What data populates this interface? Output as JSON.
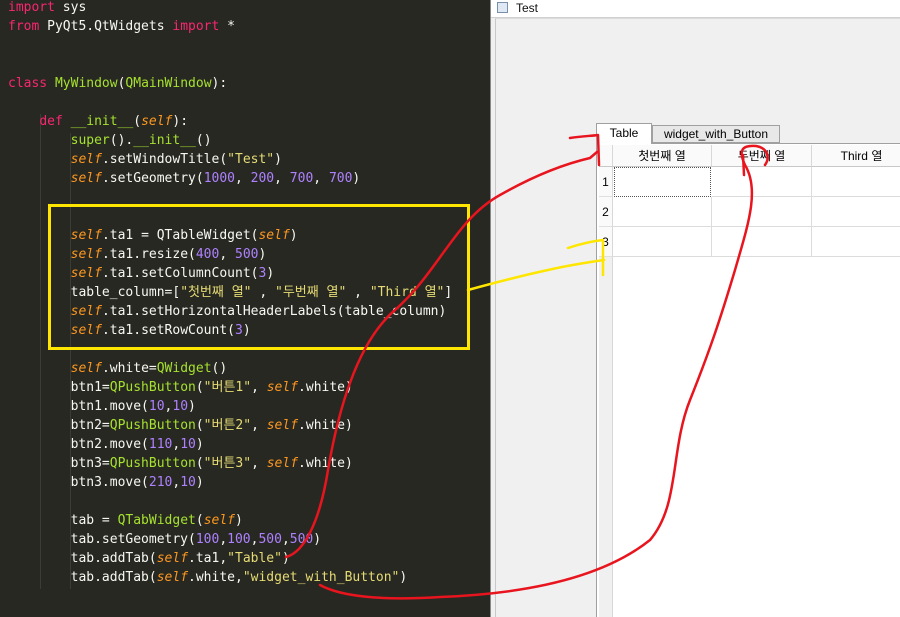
{
  "editor": {
    "lines": [
      [
        {
          "t": "import",
          "c": "kw"
        },
        {
          "t": " sys",
          "c": ""
        }
      ],
      [
        {
          "t": "from",
          "c": "kw"
        },
        {
          "t": " PyQt5.QtWidgets ",
          "c": ""
        },
        {
          "t": "import",
          "c": "kw"
        },
        {
          "t": " *",
          "c": ""
        }
      ],
      [],
      [],
      [
        {
          "t": "class",
          "c": "kw"
        },
        {
          "t": " ",
          "c": ""
        },
        {
          "t": "MyWindow",
          "c": "cls"
        },
        {
          "t": "(",
          "c": ""
        },
        {
          "t": "QMainWindow",
          "c": "cls"
        },
        {
          "t": "):",
          "c": ""
        }
      ],
      [],
      [
        {
          "t": "    ",
          "c": ""
        },
        {
          "t": "def",
          "c": "kw"
        },
        {
          "t": " ",
          "c": ""
        },
        {
          "t": "__init__",
          "c": "fn"
        },
        {
          "t": "(",
          "c": ""
        },
        {
          "t": "self",
          "c": "slf"
        },
        {
          "t": "):",
          "c": ""
        }
      ],
      [
        {
          "t": "        ",
          "c": ""
        },
        {
          "t": "super",
          "c": "fn"
        },
        {
          "t": "().",
          "c": ""
        },
        {
          "t": "__init__",
          "c": "fn"
        },
        {
          "t": "()",
          "c": ""
        }
      ],
      [
        {
          "t": "        ",
          "c": ""
        },
        {
          "t": "self",
          "c": "slf"
        },
        {
          "t": ".setWindowTitle(",
          "c": ""
        },
        {
          "t": "\"Test\"",
          "c": "str"
        },
        {
          "t": ")",
          "c": ""
        }
      ],
      [
        {
          "t": "        ",
          "c": ""
        },
        {
          "t": "self",
          "c": "slf"
        },
        {
          "t": ".setGeometry(",
          "c": ""
        },
        {
          "t": "1000",
          "c": "num"
        },
        {
          "t": ", ",
          "c": ""
        },
        {
          "t": "200",
          "c": "num"
        },
        {
          "t": ", ",
          "c": ""
        },
        {
          "t": "700",
          "c": "num"
        },
        {
          "t": ", ",
          "c": ""
        },
        {
          "t": "700",
          "c": "num"
        },
        {
          "t": ")",
          "c": ""
        }
      ],
      [],
      [],
      [
        {
          "t": "        ",
          "c": ""
        },
        {
          "t": "self",
          "c": "slf"
        },
        {
          "t": ".ta1 = QTableWidget(",
          "c": ""
        },
        {
          "t": "self",
          "c": "slf"
        },
        {
          "t": ")",
          "c": ""
        }
      ],
      [
        {
          "t": "        ",
          "c": ""
        },
        {
          "t": "self",
          "c": "slf"
        },
        {
          "t": ".ta1.resize(",
          "c": ""
        },
        {
          "t": "400",
          "c": "num"
        },
        {
          "t": ", ",
          "c": ""
        },
        {
          "t": "500",
          "c": "num"
        },
        {
          "t": ")",
          "c": ""
        }
      ],
      [
        {
          "t": "        ",
          "c": ""
        },
        {
          "t": "self",
          "c": "slf"
        },
        {
          "t": ".ta1.setColumnCount(",
          "c": ""
        },
        {
          "t": "3",
          "c": "num"
        },
        {
          "t": ")",
          "c": ""
        }
      ],
      [
        {
          "t": "        table_column=[",
          "c": ""
        },
        {
          "t": "\"첫번째 열\"",
          "c": "str"
        },
        {
          "t": " , ",
          "c": ""
        },
        {
          "t": "\"두번째 열\"",
          "c": "str"
        },
        {
          "t": " , ",
          "c": ""
        },
        {
          "t": "\"Third 열\"",
          "c": "str"
        },
        {
          "t": "]",
          "c": ""
        }
      ],
      [
        {
          "t": "        ",
          "c": ""
        },
        {
          "t": "self",
          "c": "slf"
        },
        {
          "t": ".ta1.setHorizontalHeaderLabels(table_column)",
          "c": ""
        }
      ],
      [
        {
          "t": "        ",
          "c": ""
        },
        {
          "t": "self",
          "c": "slf"
        },
        {
          "t": ".ta1.setRowCount(",
          "c": ""
        },
        {
          "t": "3",
          "c": "num"
        },
        {
          "t": ")",
          "c": ""
        }
      ],
      [],
      [
        {
          "t": "        ",
          "c": ""
        },
        {
          "t": "self",
          "c": "slf"
        },
        {
          "t": ".white=",
          "c": ""
        },
        {
          "t": "QWidget",
          "c": "cls"
        },
        {
          "t": "()",
          "c": ""
        }
      ],
      [
        {
          "t": "        btn1=",
          "c": ""
        },
        {
          "t": "QPushButton",
          "c": "cls"
        },
        {
          "t": "(",
          "c": ""
        },
        {
          "t": "\"버튼1\"",
          "c": "str"
        },
        {
          "t": ", ",
          "c": ""
        },
        {
          "t": "self",
          "c": "slf"
        },
        {
          "t": ".white)",
          "c": ""
        }
      ],
      [
        {
          "t": "        btn1.move(",
          "c": ""
        },
        {
          "t": "10",
          "c": "num"
        },
        {
          "t": ",",
          "c": ""
        },
        {
          "t": "10",
          "c": "num"
        },
        {
          "t": ")",
          "c": ""
        }
      ],
      [
        {
          "t": "        btn2=",
          "c": ""
        },
        {
          "t": "QPushButton",
          "c": "cls"
        },
        {
          "t": "(",
          "c": ""
        },
        {
          "t": "\"버튼2\"",
          "c": "str"
        },
        {
          "t": ", ",
          "c": ""
        },
        {
          "t": "self",
          "c": "slf"
        },
        {
          "t": ".white)",
          "c": ""
        }
      ],
      [
        {
          "t": "        btn2.move(",
          "c": ""
        },
        {
          "t": "110",
          "c": "num"
        },
        {
          "t": ",",
          "c": ""
        },
        {
          "t": "10",
          "c": "num"
        },
        {
          "t": ")",
          "c": ""
        }
      ],
      [
        {
          "t": "        btn3=",
          "c": ""
        },
        {
          "t": "QPushButton",
          "c": "cls"
        },
        {
          "t": "(",
          "c": ""
        },
        {
          "t": "\"버튼3\"",
          "c": "str"
        },
        {
          "t": ", ",
          "c": ""
        },
        {
          "t": "self",
          "c": "slf"
        },
        {
          "t": ".white)",
          "c": ""
        }
      ],
      [
        {
          "t": "        btn3.move(",
          "c": ""
        },
        {
          "t": "210",
          "c": "num"
        },
        {
          "t": ",",
          "c": ""
        },
        {
          "t": "10",
          "c": "num"
        },
        {
          "t": ")",
          "c": ""
        }
      ],
      [],
      [
        {
          "t": "        tab = ",
          "c": ""
        },
        {
          "t": "QTabWidget",
          "c": "cls"
        },
        {
          "t": "(",
          "c": ""
        },
        {
          "t": "self",
          "c": "slf"
        },
        {
          "t": ")",
          "c": ""
        }
      ],
      [
        {
          "t": "        tab.setGeometry(",
          "c": ""
        },
        {
          "t": "100",
          "c": "num"
        },
        {
          "t": ",",
          "c": ""
        },
        {
          "t": "100",
          "c": "num"
        },
        {
          "t": ",",
          "c": ""
        },
        {
          "t": "500",
          "c": "num"
        },
        {
          "t": ",",
          "c": ""
        },
        {
          "t": "500",
          "c": "num"
        },
        {
          "t": ")",
          "c": ""
        }
      ],
      [
        {
          "t": "        tab.addTab(",
          "c": ""
        },
        {
          "t": "self",
          "c": "slf"
        },
        {
          "t": ".ta1,",
          "c": ""
        },
        {
          "t": "\"Table\"",
          "c": "str"
        },
        {
          "t": ")",
          "c": ""
        }
      ],
      [
        {
          "t": "        tab.addTab(",
          "c": ""
        },
        {
          "t": "self",
          "c": "slf"
        },
        {
          "t": ".white,",
          "c": ""
        },
        {
          "t": "\"widget_with_Button\"",
          "c": "str"
        },
        {
          "t": ")",
          "c": ""
        }
      ]
    ]
  },
  "qt_window": {
    "title": "Test",
    "tabs": [
      {
        "label": "Table",
        "active": true
      },
      {
        "label": "widget_with_Button",
        "active": false
      }
    ],
    "table": {
      "column_headers": [
        "첫번째 열",
        "두번째 열",
        "Third 열"
      ],
      "row_headers": [
        "1",
        "2",
        "3"
      ]
    }
  },
  "colors": {
    "editor_bg": "#272822",
    "highlight_box": "#ffe600",
    "annotation_red": "#e8141e",
    "annotation_yellow": "#ffe600"
  }
}
